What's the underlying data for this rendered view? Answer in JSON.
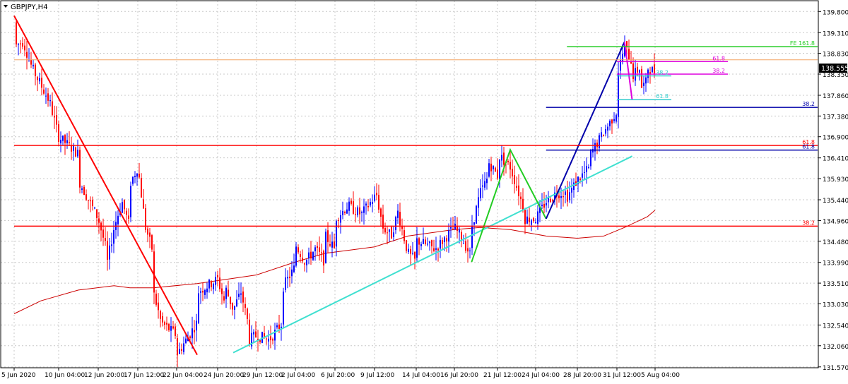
{
  "window_title": "GBPJPY,H4",
  "current_price": "138.555",
  "colors": {
    "bull": "#0000ff",
    "bear": "#ff0000",
    "grid": "#c8c8c8",
    "moving_average": "#cc0000",
    "price_line": "#f4a460",
    "fib_green": "#22cc22",
    "fib_magenta": "#dd00dd",
    "fib_cyan": "#33cccc",
    "fib_navy": "#0000aa",
    "fib_red": "#ff0000",
    "trend_cyan": "#40e0d0"
  },
  "chart_data": {
    "type": "candlestick",
    "symbol": "GBPJPY",
    "timeframe": "H4",
    "ylim": [
      131.55,
      140.05
    ],
    "y_ticks": [
      "139.800",
      "139.310",
      "138.830",
      "138.350",
      "137.860",
      "137.380",
      "136.900",
      "136.410",
      "135.930",
      "135.440",
      "134.960",
      "134.480",
      "133.990",
      "133.510",
      "133.030",
      "132.540",
      "132.060",
      "131.570"
    ],
    "x_ticks": [
      "5 Jun 2020",
      "10 Jun 04:00",
      "12 Jun 20:00",
      "17 Jun 12:00",
      "22 Jun 04:00",
      "24 Jun 20:00",
      "29 Jun 12:00",
      "2 Jul 04:00",
      "6 Jul 20:00",
      "9 Jul 12:00",
      "14 Jul 04:00",
      "16 Jul 20:00",
      "21 Jul 12:00",
      "24 Jul 04:00",
      "28 Jul 20:00",
      "31 Jul 12:00",
      "5 Aug 04:00"
    ],
    "x_label_dates": [
      "2020-06-05",
      "2020-06-10",
      "2020-06-12",
      "2020-06-17",
      "2020-06-22",
      "2020-06-24",
      "2020-06-29",
      "2020-07-02",
      "2020-07-06",
      "2020-07-09",
      "2020-07-14",
      "2020-07-16",
      "2020-07-21",
      "2020-07-24",
      "2020-07-28",
      "2020-07-31",
      "2020-08-05"
    ],
    "series_anchors": [
      [
        "2020-06-05",
        139.55
      ],
      [
        "2020-06-05",
        139.0
      ],
      [
        "2020-06-06",
        139.1
      ],
      [
        "2020-06-07",
        138.5
      ],
      [
        "2020-06-09",
        137.7
      ],
      [
        "2020-06-10",
        136.9
      ],
      [
        "2020-06-11",
        136.5
      ],
      [
        "2020-06-11",
        135.9
      ],
      [
        "2020-06-12",
        135.0
      ],
      [
        "2020-06-13",
        134.3
      ],
      [
        "2020-06-13",
        133.85
      ],
      [
        "2020-06-14",
        134.8
      ],
      [
        "2020-06-15",
        135.4
      ],
      [
        "2020-06-16",
        134.8
      ],
      [
        "2020-06-16",
        135.8
      ],
      [
        "2020-06-17",
        136.2
      ],
      [
        "2020-06-18",
        134.8
      ],
      [
        "2020-06-19",
        134.2
      ],
      [
        "2020-06-19",
        133.3
      ],
      [
        "2020-06-20",
        132.6
      ],
      [
        "2020-06-22",
        132.3
      ],
      [
        "2020-06-22",
        131.85
      ],
      [
        "2020-06-23",
        132.6
      ],
      [
        "2020-06-23",
        133.3
      ],
      [
        "2020-06-24",
        133.6
      ],
      [
        "2020-06-25",
        133.0
      ],
      [
        "2020-06-25",
        133.4
      ],
      [
        "2020-06-26",
        132.9
      ],
      [
        "2020-06-27",
        133.3
      ],
      [
        "2020-06-28",
        132.5
      ],
      [
        "2020-06-28",
        132.2
      ],
      [
        "2020-06-29",
        132.3
      ],
      [
        "2020-06-30",
        132.2
      ],
      [
        "2020-07-01",
        132.6
      ],
      [
        "2020-07-01",
        133.4
      ],
      [
        "2020-07-02",
        133.9
      ],
      [
        "2020-07-02",
        134.4
      ],
      [
        "2020-07-03",
        134.0
      ],
      [
        "2020-07-04",
        134.3
      ],
      [
        "2020-07-05",
        134.0
      ],
      [
        "2020-07-05",
        134.6
      ],
      [
        "2020-07-06",
        134.3
      ],
      [
        "2020-07-06",
        135.0
      ],
      [
        "2020-07-07",
        135.3
      ],
      [
        "2020-07-08",
        135.1
      ],
      [
        "2020-07-09",
        135.5
      ],
      [
        "2020-07-09",
        135.8
      ],
      [
        "2020-07-10",
        134.8
      ],
      [
        "2020-07-11",
        134.6
      ],
      [
        "2020-07-12",
        135.3
      ],
      [
        "2020-07-12",
        135.0
      ],
      [
        "2020-07-13",
        134.2
      ],
      [
        "2020-07-14",
        134.0
      ],
      [
        "2020-07-14",
        134.5
      ],
      [
        "2020-07-15",
        134.3
      ],
      [
        "2020-07-16",
        134.8
      ],
      [
        "2020-07-17",
        134.5
      ],
      [
        "2020-07-18",
        134.1
      ],
      [
        "2020-07-18",
        134.8
      ],
      [
        "2020-07-19",
        135.6
      ],
      [
        "2020-07-20",
        136.0
      ],
      [
        "2020-07-20",
        136.3
      ],
      [
        "2020-07-21",
        136.0
      ],
      [
        "2020-07-21",
        136.5
      ],
      [
        "2020-07-22",
        136.2
      ],
      [
        "2020-07-23",
        135.3
      ],
      [
        "2020-07-23",
        135.0
      ],
      [
        "2020-07-24",
        135.0
      ],
      [
        "2020-07-25",
        135.4
      ],
      [
        "2020-07-26",
        135.6
      ],
      [
        "2020-07-27",
        135.6
      ],
      [
        "2020-07-27",
        135.5
      ],
      [
        "2020-07-28",
        135.9
      ],
      [
        "2020-07-29",
        136.2
      ],
      [
        "2020-07-29",
        136.5
      ],
      [
        "2020-07-30",
        137.0
      ],
      [
        "2020-07-31",
        137.5
      ],
      [
        "2020-07-31",
        138.3
      ],
      [
        "2020-08-01",
        139.0
      ],
      [
        "2020-08-02",
        138.6
      ],
      [
        "2020-08-02",
        138.3
      ],
      [
        "2020-08-03",
        138.5
      ],
      [
        "2020-08-03",
        138.0
      ],
      [
        "2020-08-04",
        138.2
      ],
      [
        "2020-08-04",
        138.5
      ],
      [
        "2020-08-05",
        138.4
      ],
      [
        "2020-08-05",
        138.55
      ]
    ],
    "moving_average": [
      [
        "2020-06-05",
        132.8
      ],
      [
        "2020-06-08",
        133.1
      ],
      [
        "2020-06-11",
        133.35
      ],
      [
        "2020-06-14",
        133.45
      ],
      [
        "2020-06-16",
        133.4
      ],
      [
        "2020-06-19",
        133.4
      ],
      [
        "2020-06-23",
        133.5
      ],
      [
        "2020-06-29",
        133.7
      ],
      [
        "2020-07-02",
        134.0
      ],
      [
        "2020-07-05",
        134.2
      ],
      [
        "2020-07-09",
        134.35
      ],
      [
        "2020-07-13",
        134.6
      ],
      [
        "2020-07-16",
        134.75
      ],
      [
        "2020-07-19",
        134.8
      ],
      [
        "2020-07-22",
        134.75
      ],
      [
        "2020-07-25",
        134.6
      ],
      [
        "2020-07-28",
        134.55
      ],
      [
        "2020-07-30",
        134.6
      ],
      [
        "2020-08-01",
        134.8
      ],
      [
        "2020-08-04",
        135.05
      ],
      [
        "2020-08-05",
        135.2
      ]
    ],
    "horizontal_levels": [
      {
        "price": 138.985,
        "color": "#22cc22",
        "from": "2020-07-27",
        "label": "FE 161.8"
      },
      {
        "price": 138.68,
        "color": "#f4a460",
        "from": "2020-06-05",
        "label": ""
      },
      {
        "price": 138.64,
        "color": "#dd00dd",
        "from": "2020-07-31",
        "label": "61.8"
      },
      {
        "price": 138.35,
        "color": "#dd00dd",
        "from": "2020-07-31",
        "label": "38.2"
      },
      {
        "price": 138.31,
        "color": "#33cccc",
        "from": "2020-07-31",
        "label": "38.2"
      },
      {
        "price": 137.76,
        "color": "#33cccc",
        "from": "2020-07-31",
        "label": "61.8"
      },
      {
        "price": 137.58,
        "color": "#0000aa",
        "from": "2020-07-25",
        "label": "38.2"
      },
      {
        "price": 136.7,
        "color": "#ff0000",
        "from": "2020-06-05",
        "label": "61.8"
      },
      {
        "price": 136.59,
        "color": "#0000aa",
        "from": "2020-07-25",
        "label": "61.8"
      },
      {
        "price": 134.83,
        "color": "#ff0000",
        "from": "2020-06-05",
        "label": "38.2"
      }
    ],
    "trendlines": [
      {
        "points": [
          [
            "2020-06-05",
            139.7
          ],
          [
            "2020-06-23",
            131.85
          ]
        ],
        "color": "#ff0000"
      },
      {
        "points": [
          [
            "2020-06-26",
            131.9
          ],
          [
            "2020-08-02",
            136.45
          ]
        ],
        "color": "#40e0d0"
      },
      {
        "points": [
          [
            "2020-07-18",
            134.0
          ],
          [
            "2020-07-22",
            136.6
          ],
          [
            "2020-07-25",
            135.0
          ]
        ],
        "color": "#22cc22"
      },
      {
        "points": [
          [
            "2020-07-25",
            135.0
          ],
          [
            "2020-08-01",
            139.1
          ]
        ],
        "color": "#0000aa"
      },
      {
        "points": [
          [
            "2020-08-01",
            139.1
          ],
          [
            "2020-08-02",
            137.75
          ]
        ],
        "color": "#dd00dd"
      }
    ]
  }
}
